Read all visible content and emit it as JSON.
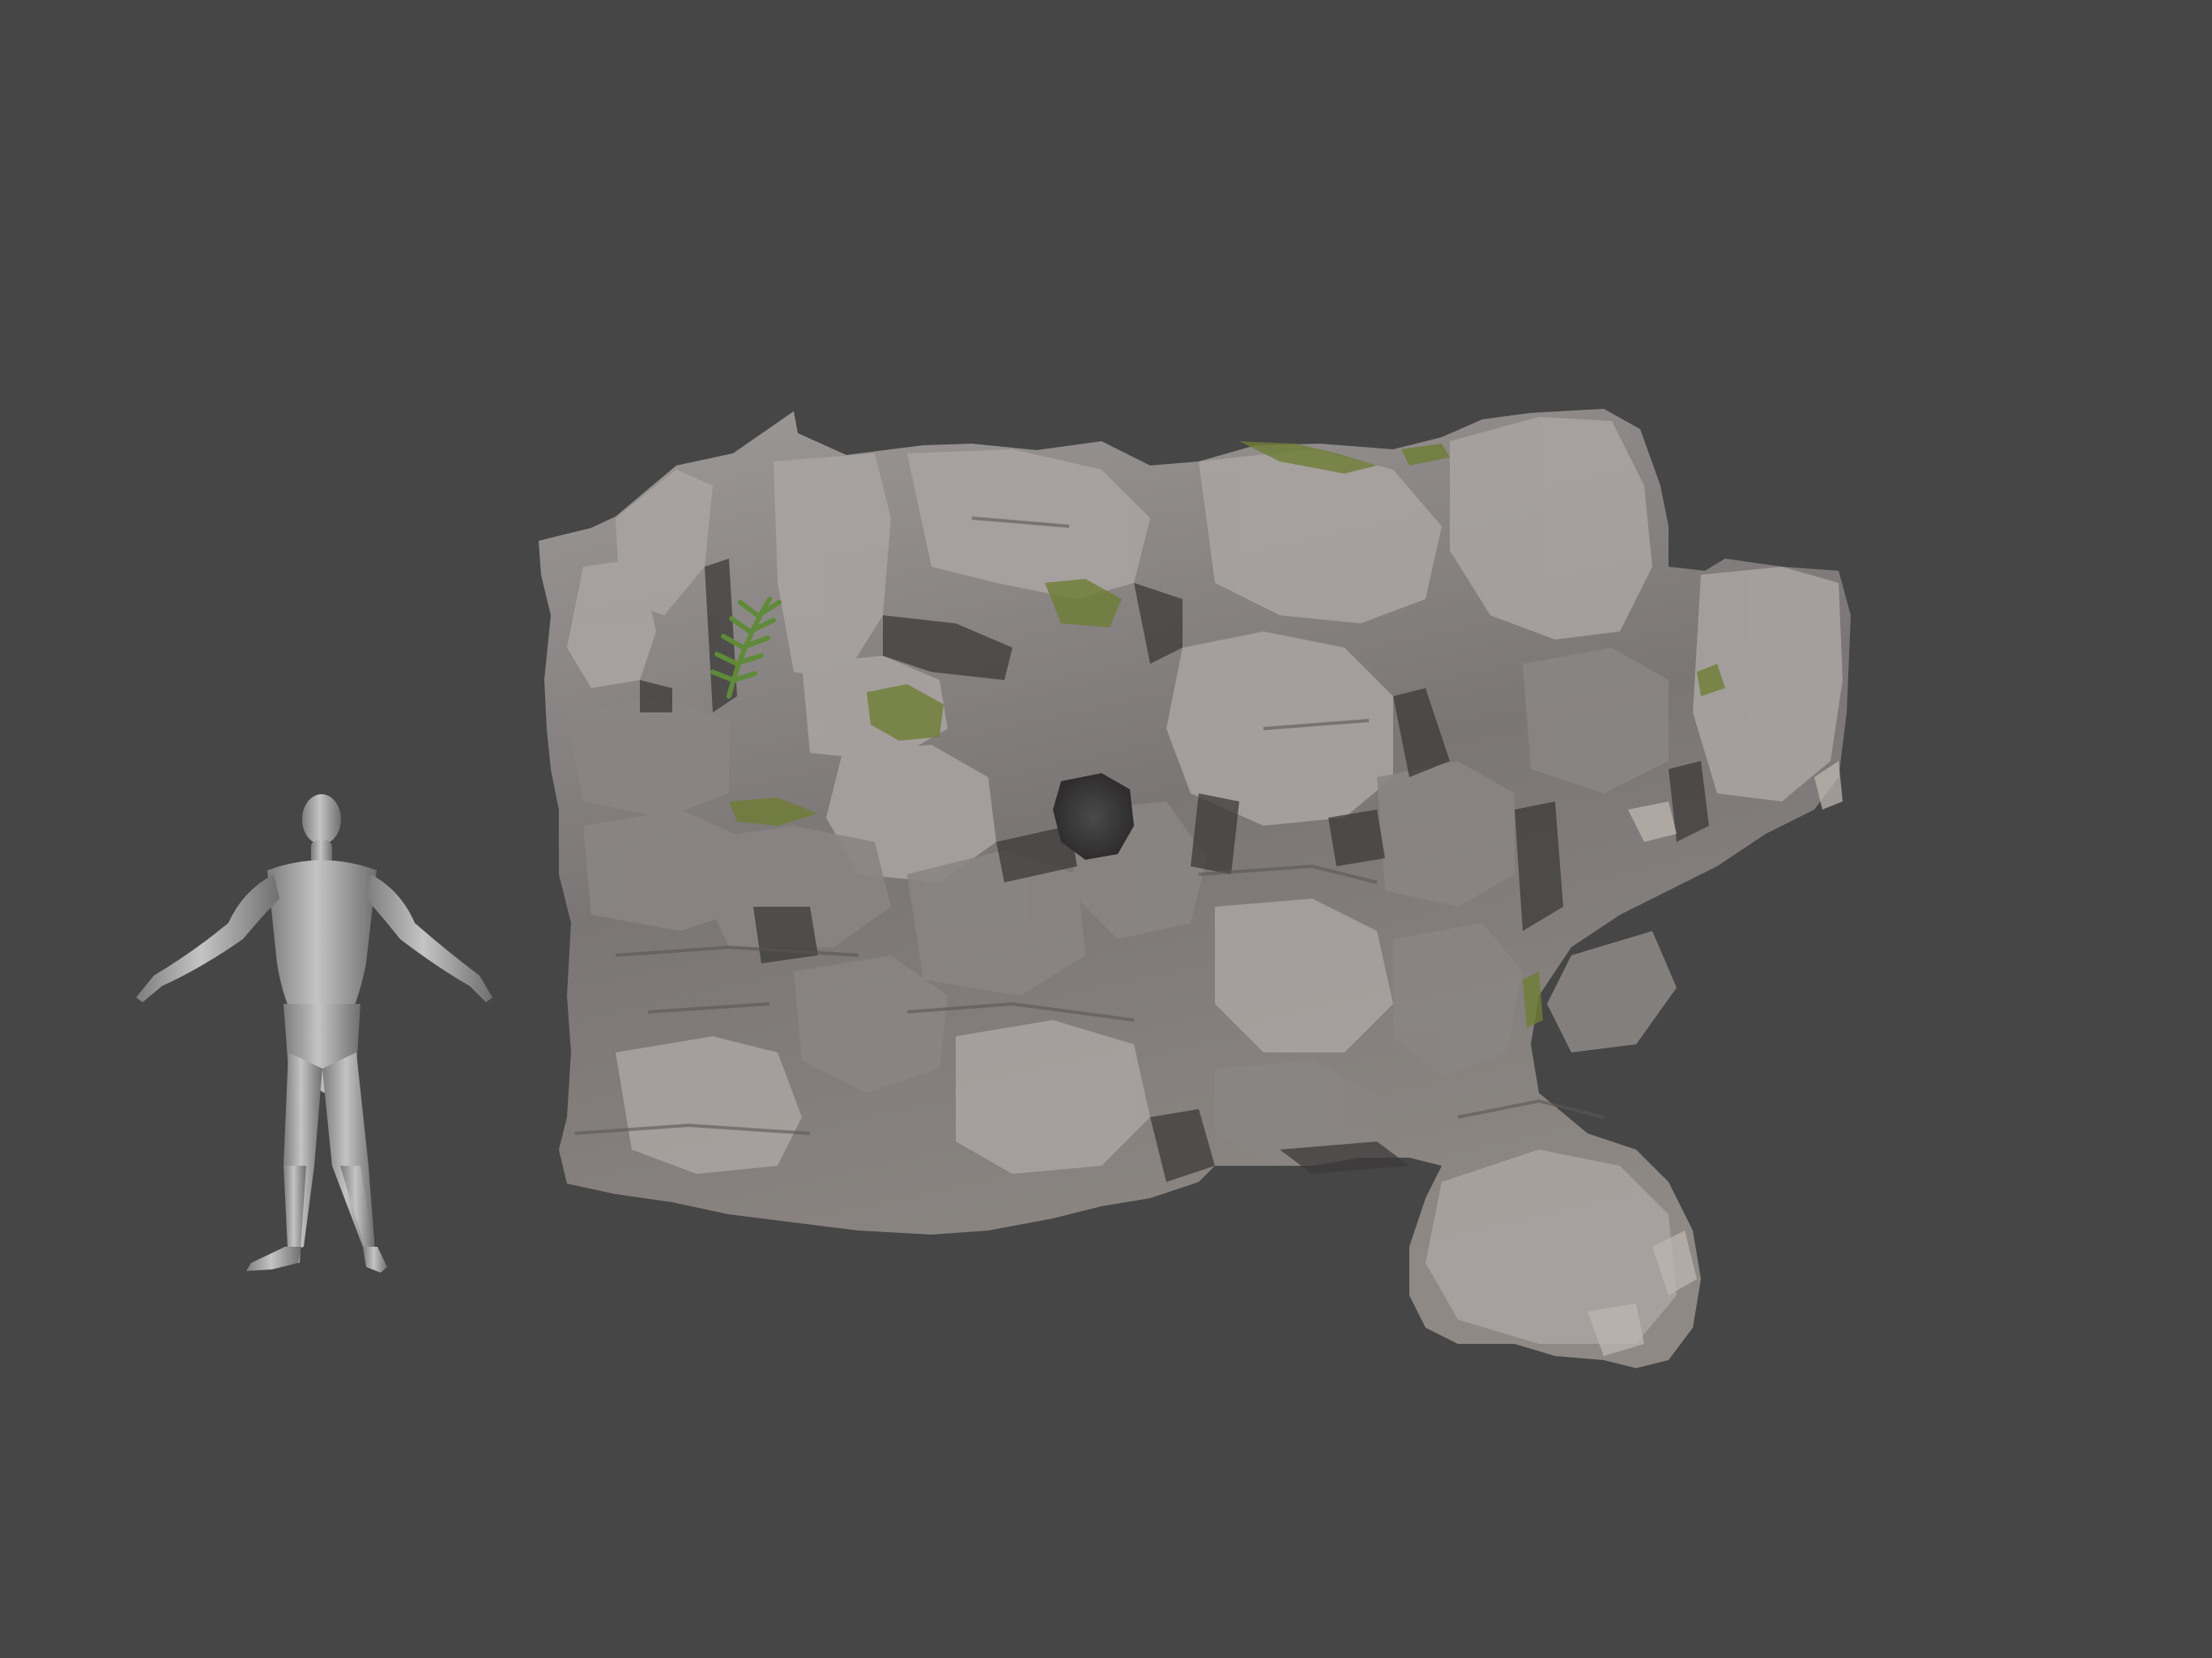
{
  "viewport": {
    "background": "#464646"
  },
  "objects": {
    "human_reference": {
      "icon": "human-scale-figure-icon",
      "color": "#a9a9a9"
    },
    "rock_cliff": {
      "icon": "rock-cliff-icon",
      "colors": {
        "base": "#7c7878",
        "light": "#b2aeab",
        "shadow": "#3b3838",
        "moss": "#6e7d34",
        "fern": "#5f8a3a"
      }
    }
  }
}
